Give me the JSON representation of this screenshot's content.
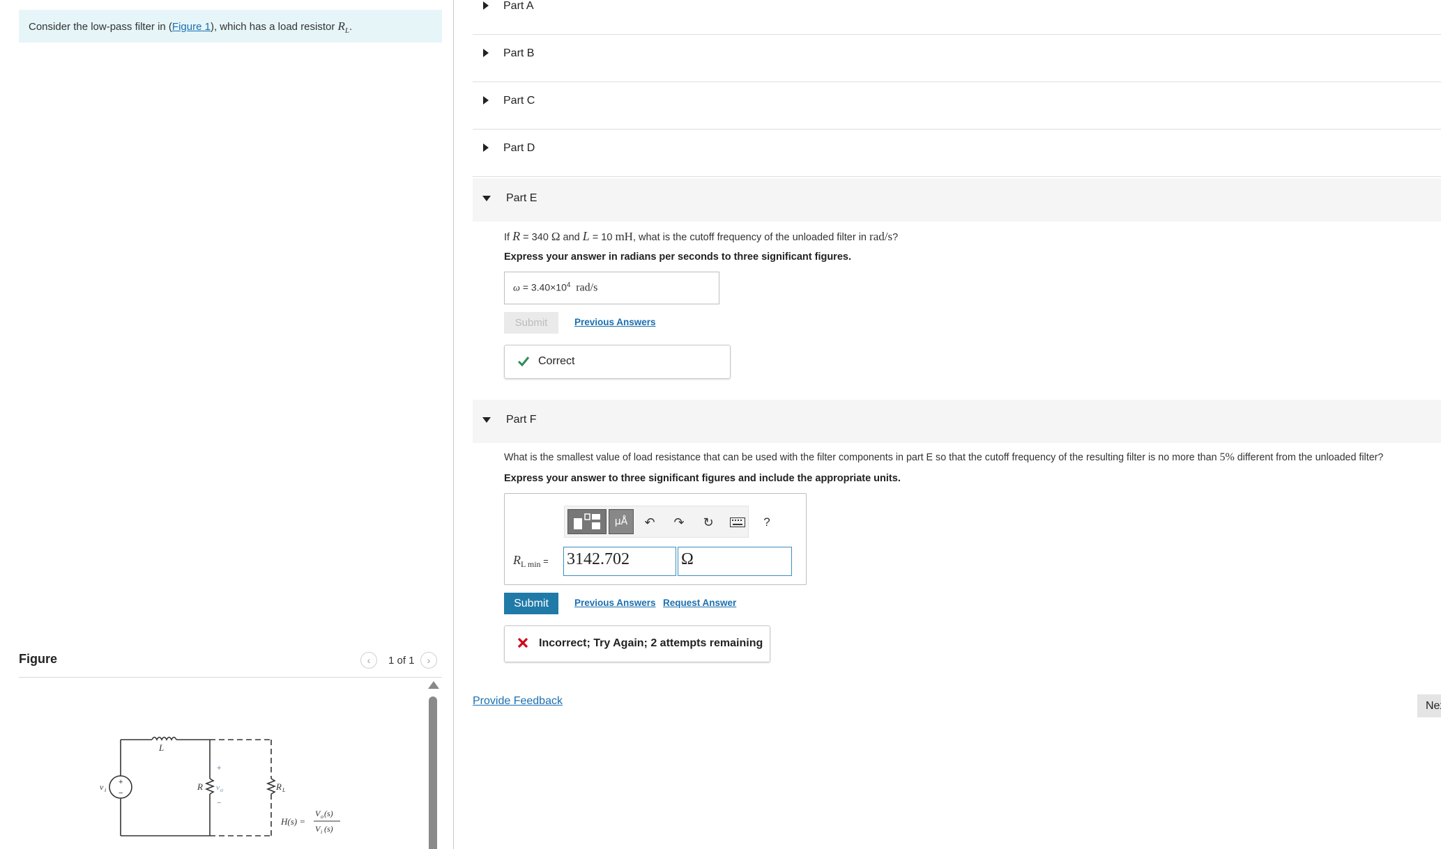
{
  "intro": {
    "prefix": "Consider the low-pass filter in (",
    "figure_link": "Figure 1",
    "suffix": "), which has a load resistor ",
    "rl_symbol": "R",
    "rl_sub": "L",
    "end": "."
  },
  "figure": {
    "title": "Figure",
    "pager": "1 of 1",
    "circuit_labels": {
      "L": "L",
      "vi": "v",
      "vi_sub": "i",
      "plus": "+",
      "minus": "−",
      "R": "R",
      "vo": "v",
      "vo_sub": "o",
      "RL": "R",
      "RL_sub": "L",
      "H": "H(s) =",
      "num": "V",
      "num_sub": "o",
      "num_tail": "(s)",
      "den": "V",
      "den_sub": "i",
      "den_tail": "(s)"
    }
  },
  "parts": {
    "a": "Part A",
    "b": "Part B",
    "c": "Part C",
    "d": "Part D",
    "e": "Part E",
    "f": "Part F"
  },
  "part_e": {
    "q_if": "If ",
    "q_R": "R",
    "q_eq1": " = 340 ",
    "q_ohm": "Ω",
    "q_and": " and ",
    "q_L": "L",
    "q_eq2": " = 10 ",
    "q_mH": "mH",
    "q_rest": ", what is the cutoff frequency of the unloaded filter in ",
    "q_unit": "rad/s",
    "q_end": "?",
    "instruction": "Express your answer in radians per seconds to three significant figures.",
    "answer_symbol": "ω",
    "answer_eq": " = ",
    "answer_mantissa": "3.40×10",
    "answer_exp": "4",
    "answer_unit": "rad/s",
    "submit": "Submit",
    "previous_answers": "Previous Answers",
    "result": "Correct"
  },
  "part_f": {
    "q_text": "What is the smallest value of load resistance that can be used with the filter components in part E so that the cutoff frequency of the resulting filter is no more than ",
    "q_pct": "5%",
    "q_end": " different from the unloaded filter?",
    "instruction": "Express your answer to three significant figures and include the appropriate units.",
    "units_btn": "μÅ",
    "help": "?",
    "label_R": "R",
    "label_sub": "L min",
    "label_eq": " =",
    "value": "3142.702",
    "unit": "Ω",
    "submit": "Submit",
    "previous_answers": "Previous Answers",
    "request_answer": "Request Answer",
    "result": "Incorrect; Try Again; 2 attempts remaining"
  },
  "footer": {
    "provide_feedback": "Provide Feedback",
    "next": "Next"
  },
  "colors": {
    "accent": "#1f7aa8",
    "correct": "#2e8b57",
    "incorrect": "#d0021b",
    "intro_bg": "#e6f5f8"
  }
}
